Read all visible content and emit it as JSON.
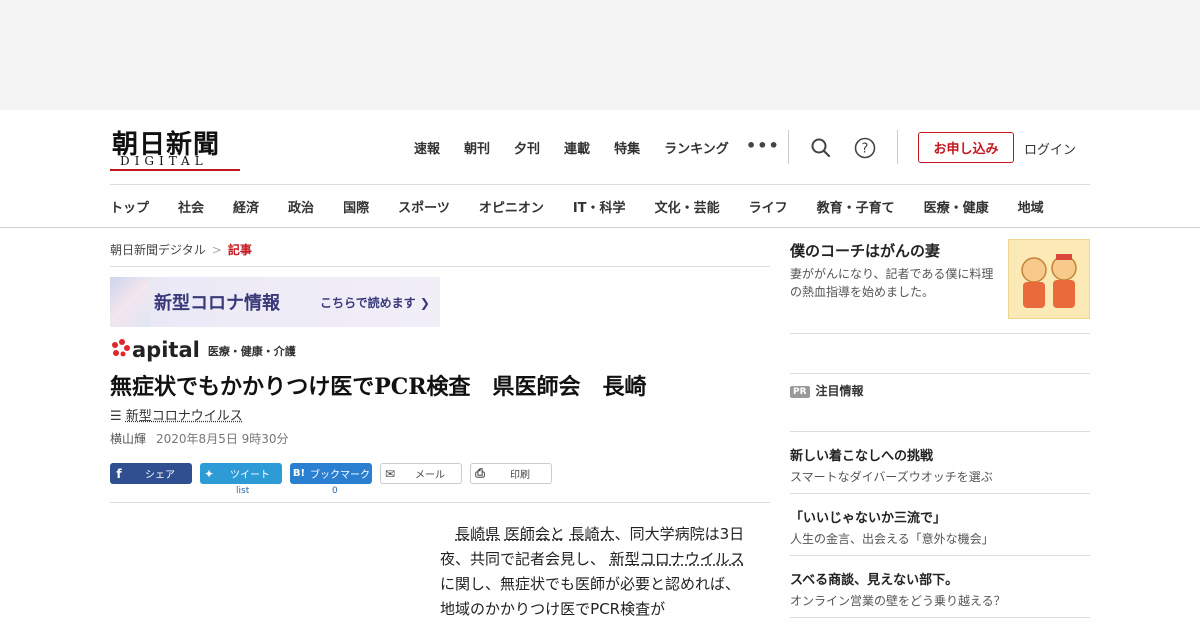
{
  "header": {
    "logo_jp": "朝日新聞",
    "logo_en": "DIGITAL",
    "top_nav": [
      "速報",
      "朝刊",
      "夕刊",
      "連載",
      "特集",
      "ランキング"
    ],
    "more_label": "•••",
    "subscribe_label": "お申し込み",
    "login_label": "ログイン"
  },
  "category_nav": [
    "トップ",
    "社会",
    "経済",
    "政治",
    "国際",
    "スポーツ",
    "オピニオン",
    "IT・科学",
    "文化・芸能",
    "ライフ",
    "教育・子育て",
    "医療・健康",
    "地域"
  ],
  "breadcrumb": {
    "home": "朝日新聞デジタル",
    "sep": ">",
    "current": "記事"
  },
  "banner": {
    "title": "新型コロナ情報",
    "sub": "こちらで読めます ❯"
  },
  "apital": {
    "logo": "apital",
    "tag": "医療・健康・介護"
  },
  "article": {
    "headline": "無症状でもかかりつけ医でPCR検査　県医師会　長崎",
    "topic": "新型コロナウイルス",
    "author": "横山輝",
    "date": "2020年8月5日 9時30分",
    "share": {
      "facebook": "シェア",
      "twitter": "ツイート",
      "hatena": "ブックマーク",
      "mail": "メール",
      "print": "印刷",
      "twitter_count": "list",
      "hatena_count": "0"
    },
    "body": {
      "p1_a": "長崎県",
      "p1_b": "医師会と",
      "p1_c": "長崎大",
      "p1_d": "、同大学病院は3日夜、共同で記者会見し、",
      "p1_e": "新型コロナウイルス",
      "p1_f": "に関し、無症状でも医師が必要と認めれば、地域のかかりつけ医でPCR検査が"
    }
  },
  "sidebar": {
    "feature": {
      "title": "僕のコーチはがんの妻",
      "desc": "妻ががんになり、記者である僕に料理の熱血指導を始めました。"
    },
    "pr": {
      "badge": "PR",
      "heading": "注目情報",
      "items": [
        {
          "title": "新しい着こなしへの挑戦",
          "sub": "スマートなダイバーズウオッチを選ぶ"
        },
        {
          "title": "「いいじゃないか三流で」",
          "sub": "人生の金言、出会える「意外な機会」"
        },
        {
          "title": "スベる商談、見えない部下。",
          "sub": "オンライン営業の壁をどう乗り越える？"
        }
      ]
    }
  },
  "colors": {
    "accent": "#c4171d",
    "facebook": "#2f4f91",
    "twitter": "#2c9bd6",
    "hatena": "#2a7fd1"
  }
}
